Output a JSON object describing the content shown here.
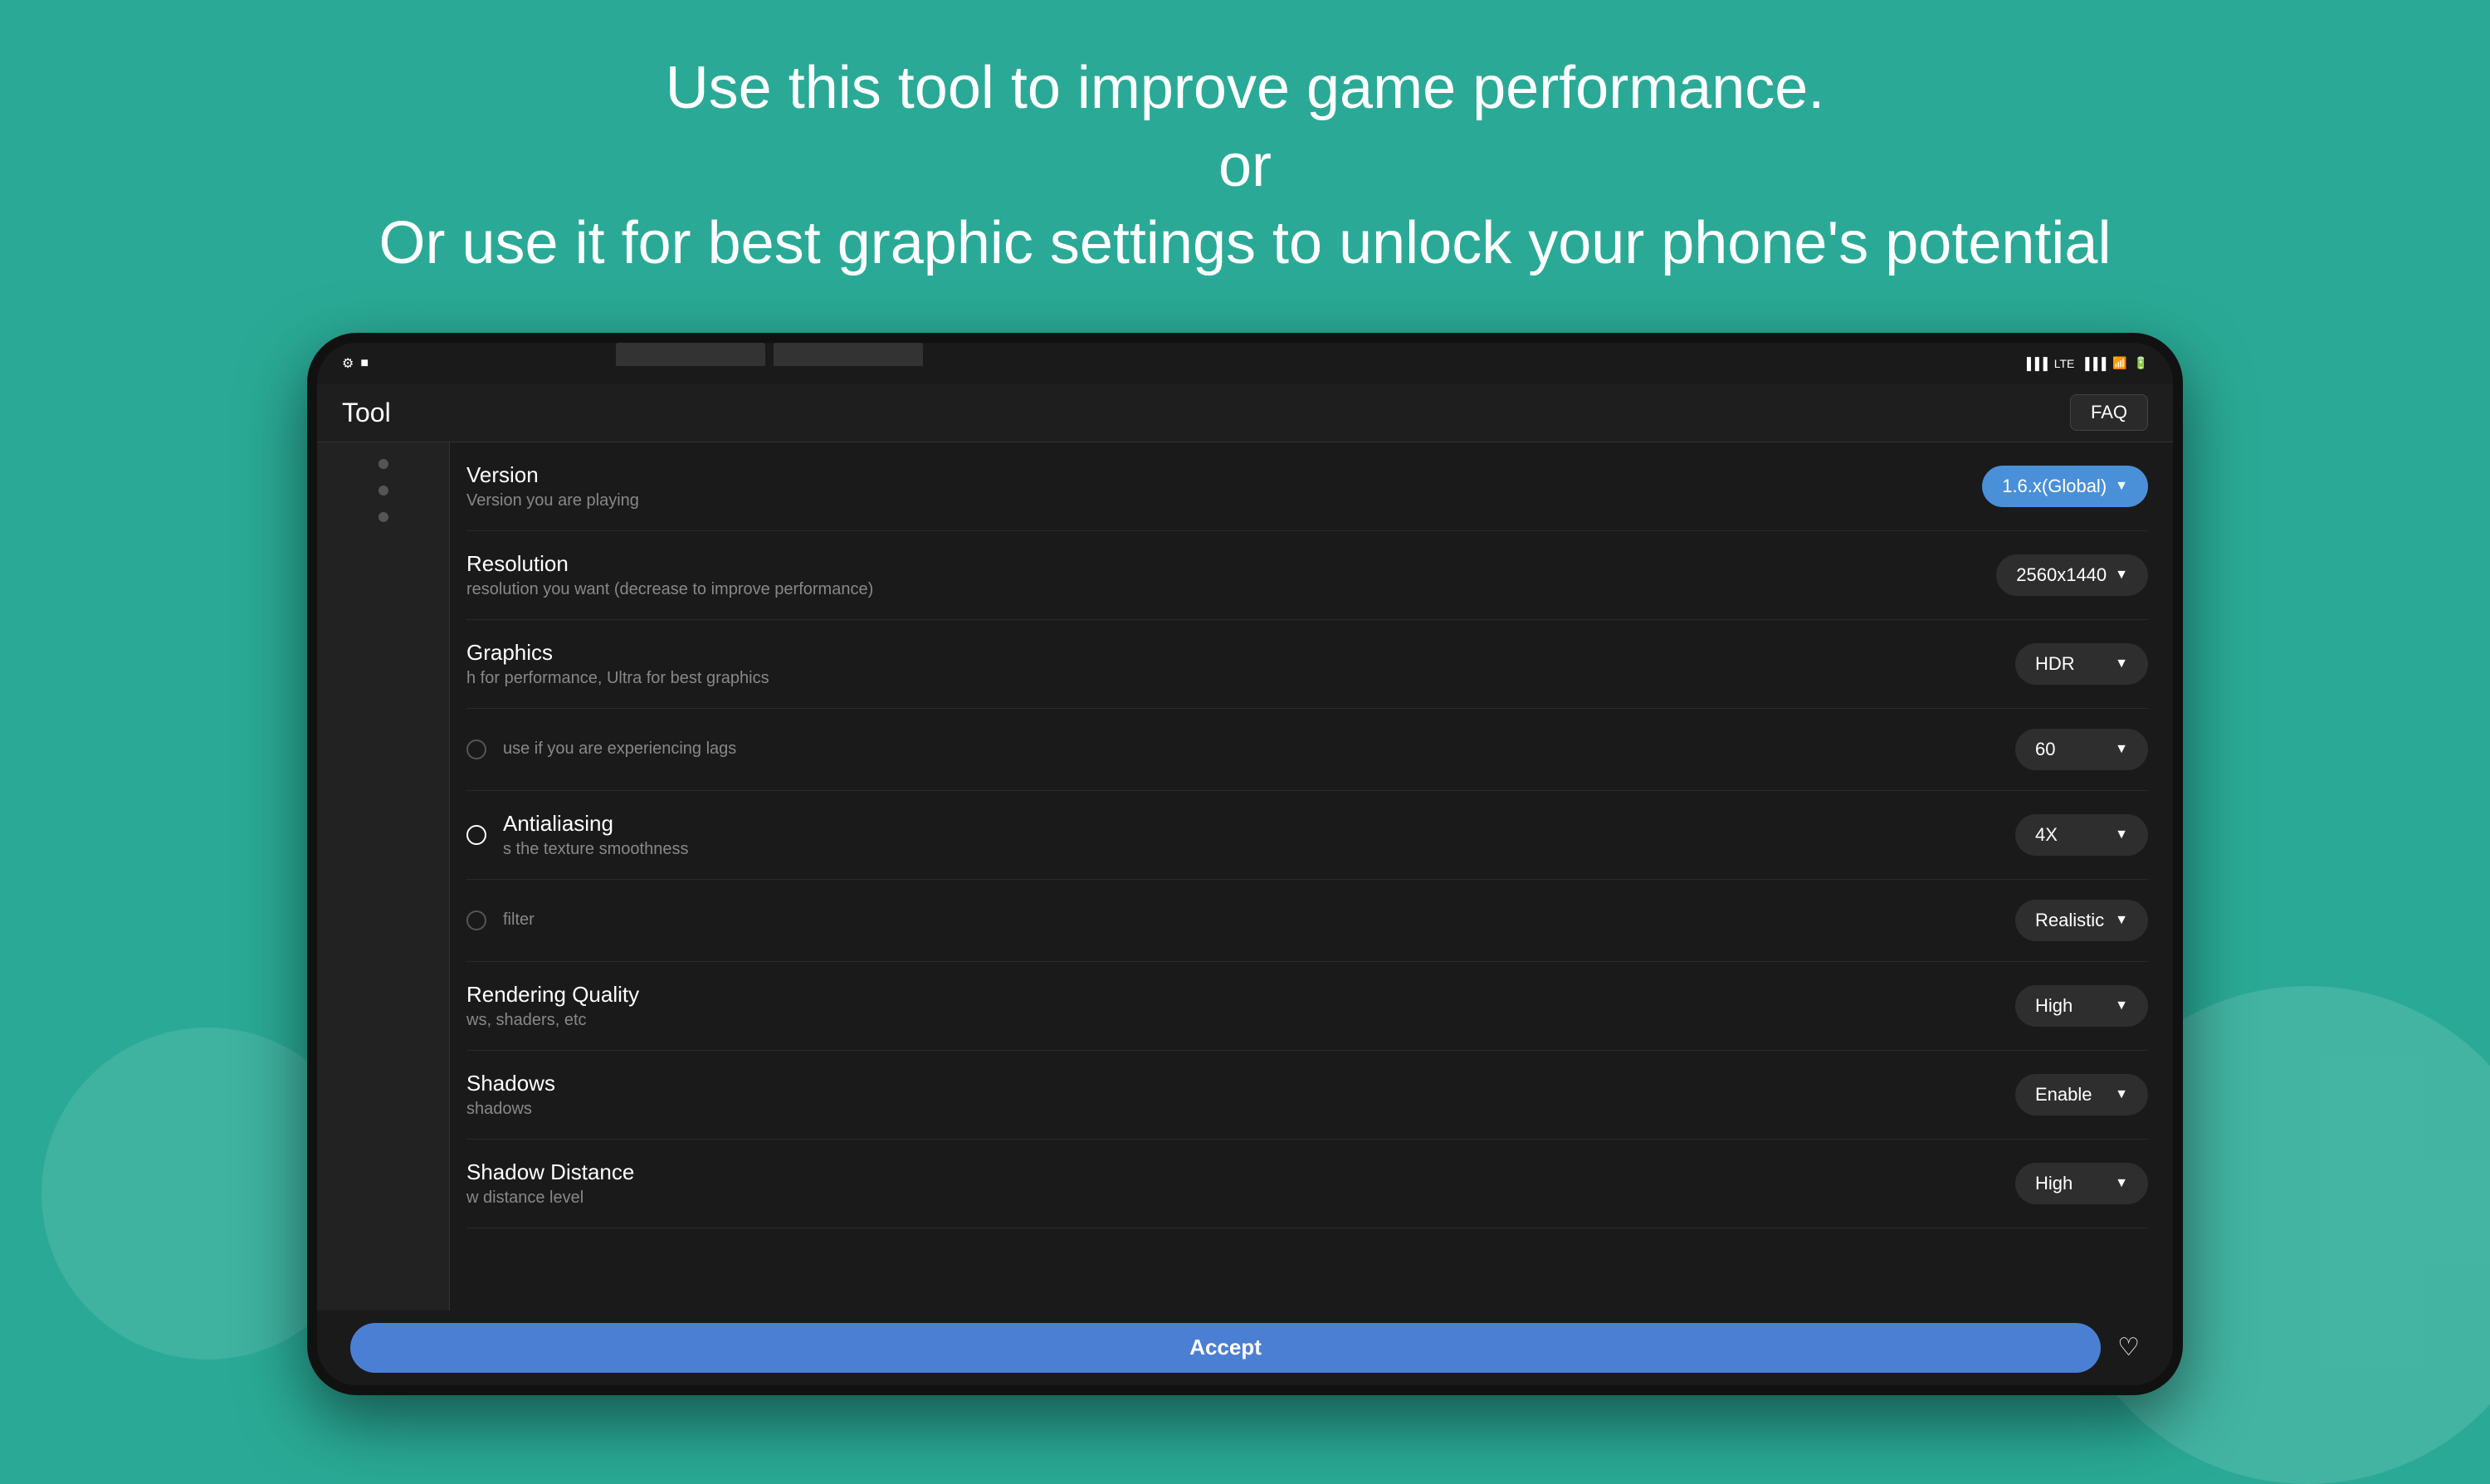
{
  "background": {
    "color": "#2aaa96"
  },
  "top_text": {
    "line1": "Use this tool to improve game performance.",
    "line2": "or",
    "line3": "Or use it for best graphic settings to unlock your phone's potential"
  },
  "device": {
    "status_bar": {
      "left_icons": "⚙ ■",
      "right_icons": "▐▐▐ ◫ ◫ ▐▐▐ ◉ 🔋"
    },
    "header": {
      "title": "Tool",
      "faq_label": "FAQ"
    },
    "settings": [
      {
        "id": "version",
        "title": "Version",
        "desc": "Version you are playing",
        "value": "1.6.x(Global)",
        "button_style": "blue",
        "has_radio": false
      },
      {
        "id": "resolution",
        "title": "ution",
        "desc": "resolution you want (decrease to improve performance)",
        "value": "2560x1440",
        "button_style": "dark",
        "has_radio": false
      },
      {
        "id": "graphics",
        "title": "ics",
        "desc": "h for performance, Ultra for best graphics",
        "value": "HDR",
        "button_style": "dark",
        "has_radio": false
      },
      {
        "id": "fps",
        "title": "",
        "desc": "use if you are experiencing lags",
        "value": "60",
        "button_style": "dark",
        "has_radio": true,
        "radio_active": false
      },
      {
        "id": "antialiasing",
        "title": "Antialiasing",
        "desc": "s the texture smoothness",
        "value": "4X",
        "button_style": "dark",
        "has_radio": true,
        "radio_active": false
      },
      {
        "id": "style",
        "title": "",
        "desc": "filter",
        "value": "Realistic",
        "button_style": "dark",
        "has_radio": true,
        "radio_active": false
      },
      {
        "id": "rendering",
        "title": "ering Quality",
        "desc": "ws, shaders, etc",
        "value": "High",
        "button_style": "dark",
        "has_radio": false
      },
      {
        "id": "shadows",
        "title": "ows",
        "desc": "shadows",
        "value": "Enable",
        "button_style": "dark",
        "has_radio": false
      },
      {
        "id": "shadow_distance",
        "title": "ow Distance",
        "desc": "w distance level",
        "value": "High",
        "button_style": "dark",
        "has_radio": false
      }
    ],
    "accept_button_label": "Accept"
  }
}
